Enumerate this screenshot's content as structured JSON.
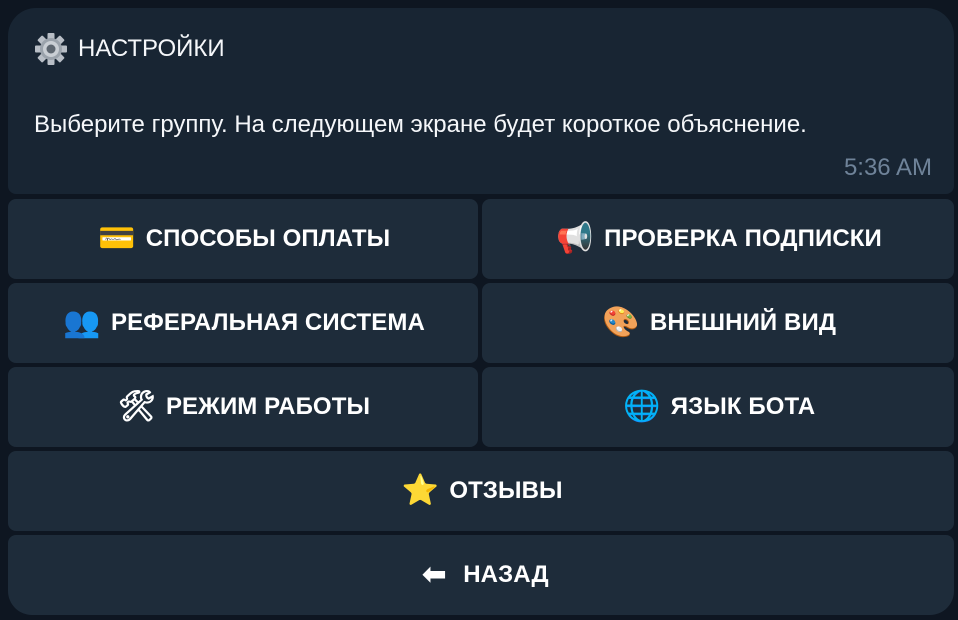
{
  "message": {
    "title_icon": "gear-icon",
    "title": "НАСТРОЙКИ",
    "text": "Выберите группу. На следующем экране будет короткое объяснение.",
    "time": "5:36 AM"
  },
  "buttons": [
    {
      "icon": "credit-card-icon",
      "glyph": "💳",
      "label": "СПОСОБЫ ОПЛАТЫ"
    },
    {
      "icon": "megaphone-icon",
      "glyph": "📢",
      "label": "ПРОВЕРКА ПОДПИСКИ"
    },
    {
      "icon": "users-icon",
      "glyph": "👥",
      "label": "РЕФЕРАЛЬНАЯ СИСТЕМА"
    },
    {
      "icon": "palette-icon",
      "glyph": "🎨",
      "label": "ВНЕШНИЙ ВИД"
    },
    {
      "icon": "tools-icon",
      "glyph": "🛠",
      "label": "РЕЖИМ РАБОТЫ"
    },
    {
      "icon": "globe-icon",
      "glyph": "🌐",
      "label": "ЯЗЫК БОТА"
    },
    {
      "icon": "star-icon",
      "glyph": "⭐",
      "label": "ОТЗЫВЫ"
    },
    {
      "icon": "back-arrow-icon",
      "glyph": "⬅",
      "label": "НАЗАД"
    }
  ],
  "colors": {
    "background": "#0e1621",
    "bubble": "#182533",
    "button": "#1e2c3a",
    "time": "#6f8399"
  }
}
